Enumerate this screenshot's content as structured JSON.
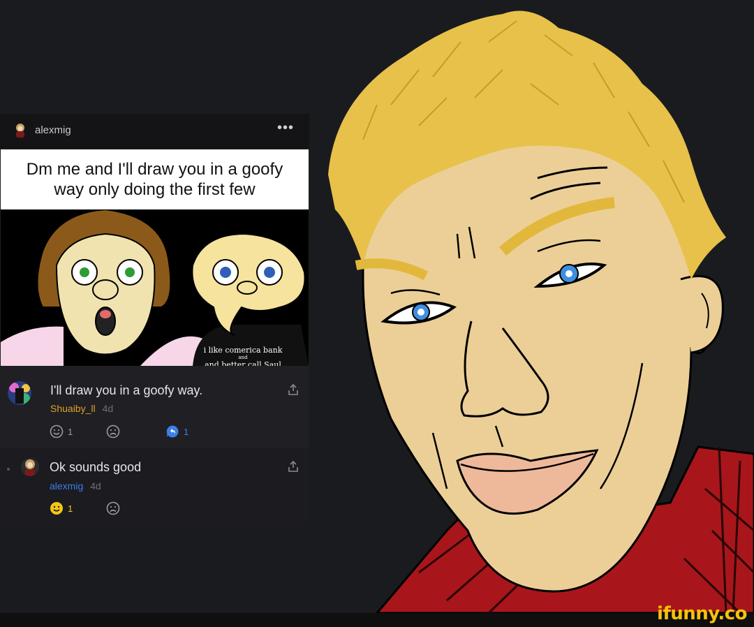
{
  "post": {
    "author": "alexmig",
    "more_label": "•••",
    "caption": "Dm me and I'll draw you in a goofy way only doing the first few",
    "image_text_line1": "i like comerica bank",
    "image_text_line2": "and",
    "image_text_line3": "and better call Saul"
  },
  "comments": [
    {
      "text": "I'll draw you in a goofy way.",
      "username": "Shuaiby_ll",
      "age": "4d",
      "username_color": "#e0a32a",
      "smile_count": "1",
      "reply_count": "1"
    },
    {
      "text": "Ok sounds good",
      "username": "alexmig",
      "age": "4d",
      "username_color": "#3d7fe6",
      "smile_count": "1"
    }
  ],
  "watermark": "ifunny.co",
  "colors": {
    "background": "#1a1b1f",
    "skin": "#eccf97",
    "hair": "#e8c14a",
    "shirt": "#a8161b",
    "iris": "#3f8fe0"
  }
}
